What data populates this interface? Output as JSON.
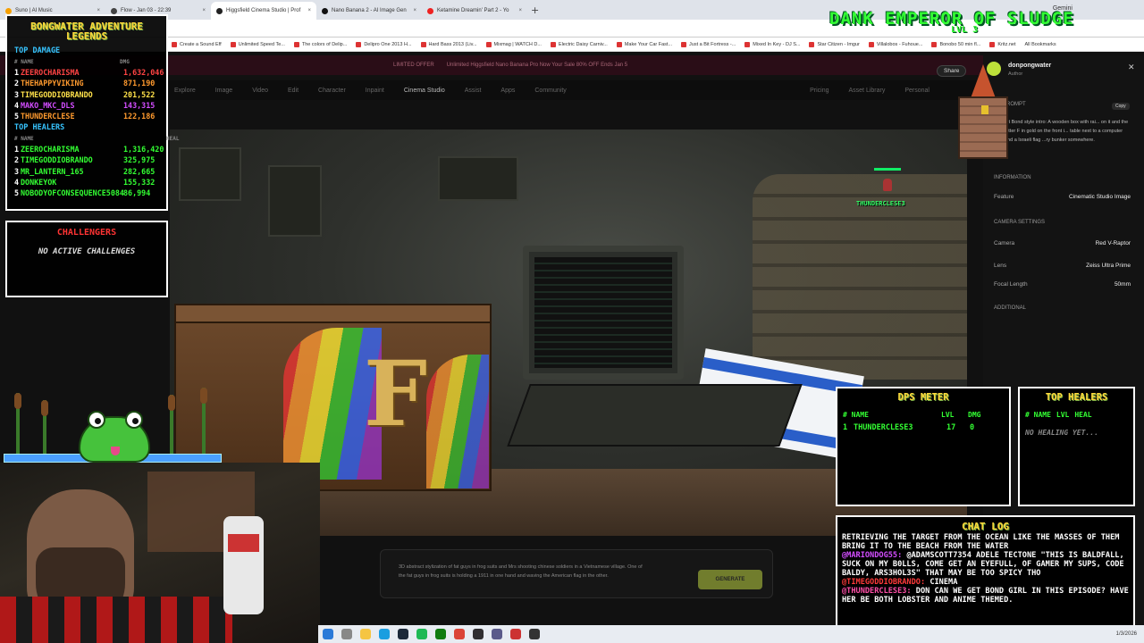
{
  "browser": {
    "tabs": [
      {
        "label": "Suno | AI Music",
        "color": "#f7a000"
      },
      {
        "label": "Flow - Jan 03 - 22:39",
        "color": "#444444"
      },
      {
        "label": "Higgsfield Cinema Studio | Prof",
        "color": "#222222",
        "active": true
      },
      {
        "label": "Nano Banana 2 - AI Image Gen",
        "color": "#111111"
      },
      {
        "label": "Ketamine Dreamin' Part 2 - Yo",
        "color": "#e22222"
      }
    ],
    "new_tab": "+",
    "gemini": "Gemini",
    "bookmarks": [
      "Create a Sound Eff",
      "Unlimited Speed Te...",
      "The colors of Delip...",
      "Delipro One 2013 H...",
      "Hard Bass 2013 (Liv...",
      "Mixmag | WATCH D...",
      "Electric Daisy Carniv...",
      "Make Your Car Fast...",
      "Just a Bit Fortress -...",
      "Mixed In Key - DJ S...",
      "Star Citizen - Imgur",
      "Villalobos - Fuhoue...",
      "Bonobo 50 min fl...",
      "Kritz.net",
      "All Bookmarks"
    ]
  },
  "app": {
    "promo": [
      "LIMITED OFFER",
      "Unlimited Higgsfield Nano Banana Pro Now Your Sale 80% OFF Ends Jan 5"
    ],
    "nav": [
      "Explore",
      "Image",
      "Video",
      "Edit",
      "Character",
      "Inpaint",
      "Cinema Studio",
      "Assist",
      "Apps",
      "Community"
    ],
    "nav_right": [
      "Pricing",
      "Asset Library",
      "Personal"
    ],
    "share": "Share",
    "author": {
      "name": "donpongwater",
      "role": "Author"
    },
    "prompt_label": "PROMPT",
    "copy": "Copy",
    "prompt_text": "...t Bond style intro: A wooden box with rai... on it and the letter F in gold on the front i... table next to a computer and a Israeli flag ...ry bunker somewhere.",
    "info_label": "INFORMATION",
    "feature_label": "Feature",
    "feature_value": "Cinematic Studio Image",
    "camera_section": "CAMERA SETTINGS",
    "camera_label": "Camera",
    "camera_value": "Red V-Raptor",
    "lens_label": "Lens",
    "lens_value": "Zeiss Ultra Prime",
    "focal_label": "Focal Length",
    "focal_value": "50mm",
    "additional": "ADDITIONAL",
    "bottom_prompt": "3D abstract stylization of fat guys in frog suits and Mrs shooting chinese soldiers in a Vietnamese village. One of the fat guys in frog suits is holding a 1911 in one hand and waving the American flag in the other.",
    "generate": "GENERATE"
  },
  "overlay": {
    "title": "DANK EMPEROR OF SLUDGE",
    "level": "LVL 3",
    "player_name": "THUNDERCLESE3",
    "legends_title": "BONGWATER ADVENTURE LEGENDS",
    "top_damage_label": "TOP DAMAGE",
    "name_header": "# NAME",
    "dmg_header": "DMG",
    "heal_header": "HEAL",
    "top_damage": [
      {
        "rank": "1",
        "name": "ZEEROCHARISMA",
        "value": "1,632,046",
        "color": "red"
      },
      {
        "rank": "2",
        "name": "THEHAPPYVIKING",
        "value": "871,190",
        "color": "orange"
      },
      {
        "rank": "3",
        "name": "TIMEGODDIOBRANDO",
        "value": "201,522",
        "color": "yel"
      },
      {
        "rank": "4",
        "name": "MAKO_MKC_DLS",
        "value": "143,315",
        "color": "mag"
      },
      {
        "rank": "5",
        "name": "THUNDERCLESE",
        "value": "122,186",
        "color": "orange"
      }
    ],
    "top_healers_label": "TOP HEALERS",
    "top_healers": [
      {
        "rank": "1",
        "name": "ZEEROCHARISMA",
        "value": "1,316,420",
        "color": "grn"
      },
      {
        "rank": "2",
        "name": "TIMEGODDIOBRANDO",
        "value": "325,975",
        "color": "grn"
      },
      {
        "rank": "3",
        "name": "MR_LANTERN_165",
        "value": "282,665",
        "color": "grn"
      },
      {
        "rank": "4",
        "name": "DONKEYOK",
        "value": "155,332",
        "color": "grn"
      },
      {
        "rank": "5",
        "name": "NOBODYOFCONSEQUENCE5084",
        "value": "86,994",
        "color": "grn"
      }
    ],
    "challengers_title": "CHALLENGERS",
    "challengers_empty": "NO ACTIVE CHALLENGES",
    "dps_title": "DPS METER",
    "dps_headers": [
      "# NAME",
      "LVL",
      "DMG"
    ],
    "dps_row": {
      "rank": "1",
      "name": "THUNDERCLESE3",
      "lvl": "17",
      "dmg": "0"
    },
    "healers_panel_title": "TOP HEALERS",
    "healers_headers": [
      "# NAME",
      "LVL",
      "HEAL"
    ],
    "healers_empty": "NO HEALING YET...",
    "chat_title": "CHAT LOG",
    "chat": [
      {
        "user": "",
        "text": "RETRIEVING THE TARGET FROM THE OCEAN LIKE THE MASSES OF THEM BRING IT TO THE BEACH FROM THE WATER"
      },
      {
        "user": "@MARIONDOG55:",
        "text": "@ADAMSCOTT7354 ADELE TECTONE \"THIS IS BALDFALL, SUCK ON MY B0LLS, COME GET AN EYEFULL, OF GAMER MY SUPS, CODE BALDY, ARS3HOL3S\" THAT MAY BE TOO SPICY THO"
      },
      {
        "user": "@TIMEGODDIOBRANDO:",
        "text": "CINEMA"
      },
      {
        "user": "@THUNDERCLESE3:",
        "text": "DON CAN WE GET BOND GIRL IN THIS EPISODE? HAVE HER BE BOTH LOBSTER AND ANIME THEMED."
      }
    ]
  },
  "taskbar": {
    "clock": "1/3/2026"
  }
}
